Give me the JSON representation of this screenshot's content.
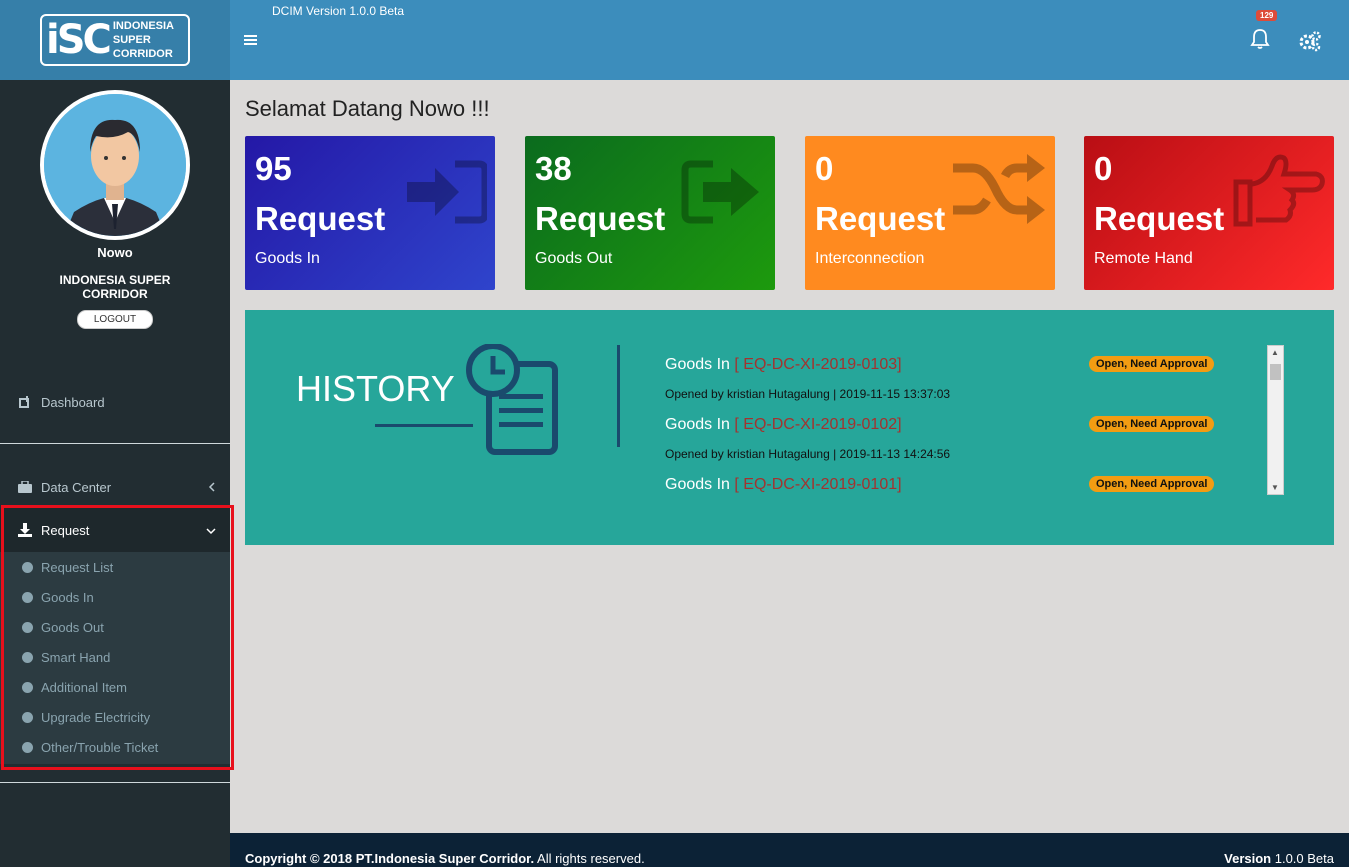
{
  "header": {
    "version": "DCIM Version 1.0.0 Beta",
    "notification_count": "129"
  },
  "logo": {
    "mark": "iSC",
    "line1": "INDONESIA",
    "line2": "SUPER",
    "line3": "CORRIDOR"
  },
  "user": {
    "name": "Nowo",
    "company": "INDONESIA SUPER CORRIDOR",
    "logout_label": "LOGOUT"
  },
  "sidebar": {
    "dashboard": "Dashboard",
    "data_center": "Data Center",
    "request": "Request",
    "request_items": [
      "Request List",
      "Goods In",
      "Goods Out",
      "Smart Hand",
      "Additional Item",
      "Upgrade Electricity",
      "Other/Trouble Ticket"
    ]
  },
  "main": {
    "welcome": "Selamat Datang Nowo !!!",
    "boxes": [
      {
        "count": "95",
        "word": "Request",
        "label": "Goods In",
        "icon": "sign-in-icon"
      },
      {
        "count": "38",
        "word": "Request",
        "label": "Goods Out",
        "icon": "sign-out-icon"
      },
      {
        "count": "0",
        "word": "Request",
        "label": "Interconnection",
        "icon": "random-icon"
      },
      {
        "count": "0",
        "word": "Request",
        "label": "Remote Hand",
        "icon": "hand-pointer-icon"
      }
    ],
    "history": {
      "title": "HISTORY",
      "entries": [
        {
          "type": "Goods In",
          "code": "[ EQ-DC-XI-2019-0103]",
          "status": "Open, Need Approval",
          "meta": "Opened by kristian Hutagalung | 2019-11-15 13:37:03"
        },
        {
          "type": "Goods In",
          "code": "[ EQ-DC-XI-2019-0102]",
          "status": "Open, Need Approval",
          "meta": "Opened by kristian Hutagalung | 2019-11-13 14:24:56"
        },
        {
          "type": "Goods In",
          "code": "[ EQ-DC-XI-2019-0101]",
          "status": "Open, Need Approval",
          "meta": ""
        }
      ]
    }
  },
  "footer": {
    "copyright_bold": "Copyright © 2018 PT.Indonesia Super Corridor.",
    "copyright_rest": " All rights reserved.",
    "version_bold": "Version",
    "version_value": " 1.0.0 Beta"
  },
  "colors": {
    "header": "#3c8dbc",
    "sidebar": "#222d32",
    "history_bg": "#26a69a",
    "badge": "#f39c12",
    "highlight": "#e8101c"
  }
}
